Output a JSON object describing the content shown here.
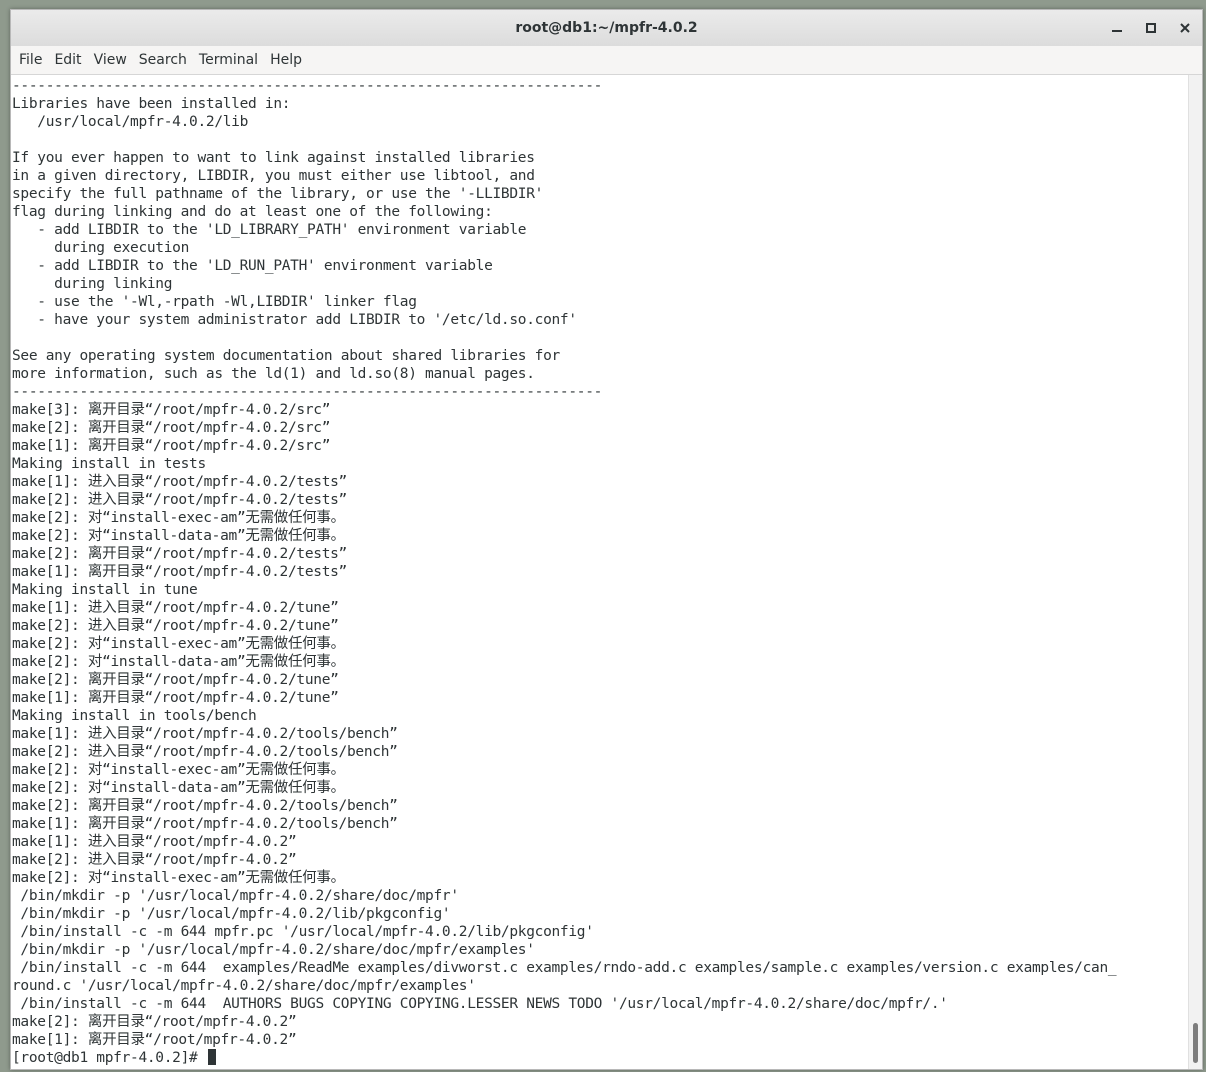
{
  "window": {
    "title": "root@db1:~/mpfr-4.0.2"
  },
  "menu": [
    "File",
    "Edit",
    "View",
    "Search",
    "Terminal",
    "Help"
  ],
  "icons": {
    "minimize": "minimize-icon",
    "maximize": "maximize-icon",
    "close": "close-icon"
  },
  "terminal": {
    "lines": [
      "----------------------------------------------------------------------",
      "Libraries have been installed in:",
      "   /usr/local/mpfr-4.0.2/lib",
      "",
      "If you ever happen to want to link against installed libraries",
      "in a given directory, LIBDIR, you must either use libtool, and",
      "specify the full pathname of the library, or use the '-LLIBDIR'",
      "flag during linking and do at least one of the following:",
      "   - add LIBDIR to the 'LD_LIBRARY_PATH' environment variable",
      "     during execution",
      "   - add LIBDIR to the 'LD_RUN_PATH' environment variable",
      "     during linking",
      "   - use the '-Wl,-rpath -Wl,LIBDIR' linker flag",
      "   - have your system administrator add LIBDIR to '/etc/ld.so.conf'",
      "",
      "See any operating system documentation about shared libraries for",
      "more information, such as the ld(1) and ld.so(8) manual pages.",
      "----------------------------------------------------------------------",
      "make[3]: 离开目录“/root/mpfr-4.0.2/src”",
      "make[2]: 离开目录“/root/mpfr-4.0.2/src”",
      "make[1]: 离开目录“/root/mpfr-4.0.2/src”",
      "Making install in tests",
      "make[1]: 进入目录“/root/mpfr-4.0.2/tests”",
      "make[2]: 进入目录“/root/mpfr-4.0.2/tests”",
      "make[2]: 对“install-exec-am”无需做任何事。",
      "make[2]: 对“install-data-am”无需做任何事。",
      "make[2]: 离开目录“/root/mpfr-4.0.2/tests”",
      "make[1]: 离开目录“/root/mpfr-4.0.2/tests”",
      "Making install in tune",
      "make[1]: 进入目录“/root/mpfr-4.0.2/tune”",
      "make[2]: 进入目录“/root/mpfr-4.0.2/tune”",
      "make[2]: 对“install-exec-am”无需做任何事。",
      "make[2]: 对“install-data-am”无需做任何事。",
      "make[2]: 离开目录“/root/mpfr-4.0.2/tune”",
      "make[1]: 离开目录“/root/mpfr-4.0.2/tune”",
      "Making install in tools/bench",
      "make[1]: 进入目录“/root/mpfr-4.0.2/tools/bench”",
      "make[2]: 进入目录“/root/mpfr-4.0.2/tools/bench”",
      "make[2]: 对“install-exec-am”无需做任何事。",
      "make[2]: 对“install-data-am”无需做任何事。",
      "make[2]: 离开目录“/root/mpfr-4.0.2/tools/bench”",
      "make[1]: 离开目录“/root/mpfr-4.0.2/tools/bench”",
      "make[1]: 进入目录“/root/mpfr-4.0.2”",
      "make[2]: 进入目录“/root/mpfr-4.0.2”",
      "make[2]: 对“install-exec-am”无需做任何事。",
      " /bin/mkdir -p '/usr/local/mpfr-4.0.2/share/doc/mpfr'",
      " /bin/mkdir -p '/usr/local/mpfr-4.0.2/lib/pkgconfig'",
      " /bin/install -c -m 644 mpfr.pc '/usr/local/mpfr-4.0.2/lib/pkgconfig'",
      " /bin/mkdir -p '/usr/local/mpfr-4.0.2/share/doc/mpfr/examples'",
      " /bin/install -c -m 644  examples/ReadMe examples/divworst.c examples/rndo-add.c examples/sample.c examples/version.c examples/can_",
      "round.c '/usr/local/mpfr-4.0.2/share/doc/mpfr/examples'",
      " /bin/install -c -m 644  AUTHORS BUGS COPYING COPYING.LESSER NEWS TODO '/usr/local/mpfr-4.0.2/share/doc/mpfr/.'",
      "make[2]: 离开目录“/root/mpfr-4.0.2”",
      "make[1]: 离开目录“/root/mpfr-4.0.2”"
    ],
    "prompt": "[root@db1 mpfr-4.0.2]# "
  }
}
